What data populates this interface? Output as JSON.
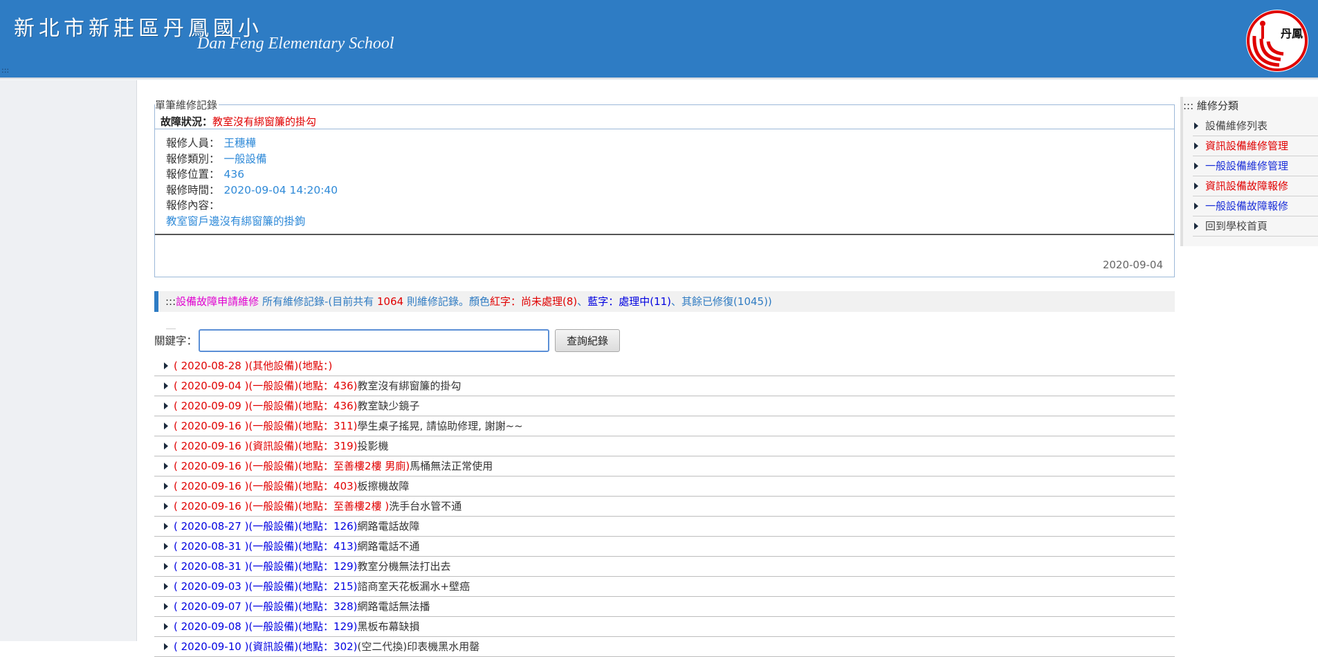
{
  "header": {
    "title_zh": "新北市新莊區丹鳳國小",
    "title_en": "Dan Feng Elementary School",
    "logo_text": "丹鳳",
    "strip_marker": ":::"
  },
  "record": {
    "legend": "單筆維修記錄",
    "status_label": "故障狀況：",
    "status_value": "教室沒有綁窗簾的掛勾",
    "reporter_label": "報修人員：",
    "reporter": "王穗樺",
    "category_label": "報修類別：",
    "category": "一般設備",
    "location_label": "報修位置：",
    "location": "436",
    "time_label": "報修時間：",
    "time": "2020-09-04 14:20:40",
    "content_label": "報修內容：",
    "content": "教室窗戶邊沒有綁窗簾的掛鉤",
    "footer_date": "2020-09-04"
  },
  "info_bar": {
    "prefix": ":::",
    "link": "設備故障申請維修",
    "text1": " 所有維修記錄-(目前共有 ",
    "total": "1064",
    "text2": " 則維修記錄。顏色",
    "red_label": "紅字：尚未處理(8)",
    "sep1": "、",
    "blue_label": "藍字：處理中(11)",
    "sep2": "、",
    "rest": "其餘已修復(1045))"
  },
  "search": {
    "label": "關鍵字：",
    "value": "",
    "placeholder": "",
    "button": "查詢紀錄"
  },
  "records": [
    {
      "color": "red",
      "date": "2020-08-28",
      "category": "其他設備",
      "location": "",
      "desc": ""
    },
    {
      "color": "red",
      "date": "2020-09-04",
      "category": "一般設備",
      "location": "436",
      "desc": "教室沒有綁窗簾的掛勾"
    },
    {
      "color": "red",
      "date": "2020-09-09",
      "category": "一般設備",
      "location": "436",
      "desc": "教室缺少鏡子"
    },
    {
      "color": "red",
      "date": "2020-09-16",
      "category": "一般設備",
      "location": "311",
      "desc": "學生桌子搖晃, 請協助修理, 謝謝~~"
    },
    {
      "color": "red",
      "date": "2020-09-16",
      "category": "資訊設備",
      "location": "319",
      "desc": "投影機"
    },
    {
      "color": "red",
      "date": "2020-09-16",
      "category": "一般設備",
      "location": "至善樓2樓 男廁",
      "desc": "馬桶無法正常使用"
    },
    {
      "color": "red",
      "date": "2020-09-16",
      "category": "一般設備",
      "location": "403",
      "desc": "板擦機故障"
    },
    {
      "color": "red",
      "date": "2020-09-16",
      "category": "一般設備",
      "location": "至善樓2樓 ",
      "desc": "洗手台水管不通"
    },
    {
      "color": "blue",
      "date": "2020-08-27",
      "category": "一般設備",
      "location": "126",
      "desc": "網路電話故障"
    },
    {
      "color": "blue",
      "date": "2020-08-31",
      "category": "一般設備",
      "location": "413",
      "desc": "網路電話不通"
    },
    {
      "color": "blue",
      "date": "2020-08-31",
      "category": "一般設備",
      "location": "129",
      "desc": "教室分機無法打出去"
    },
    {
      "color": "blue",
      "date": "2020-09-03",
      "category": "一般設備",
      "location": "215",
      "desc": "諮商室天花板漏水+壁癌"
    },
    {
      "color": "blue",
      "date": "2020-09-07",
      "category": "一般設備",
      "location": "328",
      "desc": "網路電話無法播"
    },
    {
      "color": "blue",
      "date": "2020-09-08",
      "category": "一般設備",
      "location": "129",
      "desc": "黑板布幕缺損"
    },
    {
      "color": "blue",
      "date": "2020-09-10",
      "category": "資訊設備",
      "location": "302",
      "desc": "(空二代換)印表機黑水用罄"
    }
  ],
  "sidebar": {
    "title": "::: 維修分類",
    "items": [
      {
        "label": "設備維修列表",
        "color": "gray"
      },
      {
        "label": "資訊設備維修管理",
        "color": "red"
      },
      {
        "label": "一般設備維修管理",
        "color": "blue"
      },
      {
        "label": "資訊設備故障報修",
        "color": "red"
      },
      {
        "label": "一般設備故障報修",
        "color": "blue"
      },
      {
        "label": "回到學校首頁",
        "color": "gray"
      }
    ]
  },
  "colors": {
    "header_bg": "#2e7cc4",
    "pending_red": "#e00000",
    "processing_blue": "#0000e0",
    "link_blue": "#2f8ad8"
  }
}
